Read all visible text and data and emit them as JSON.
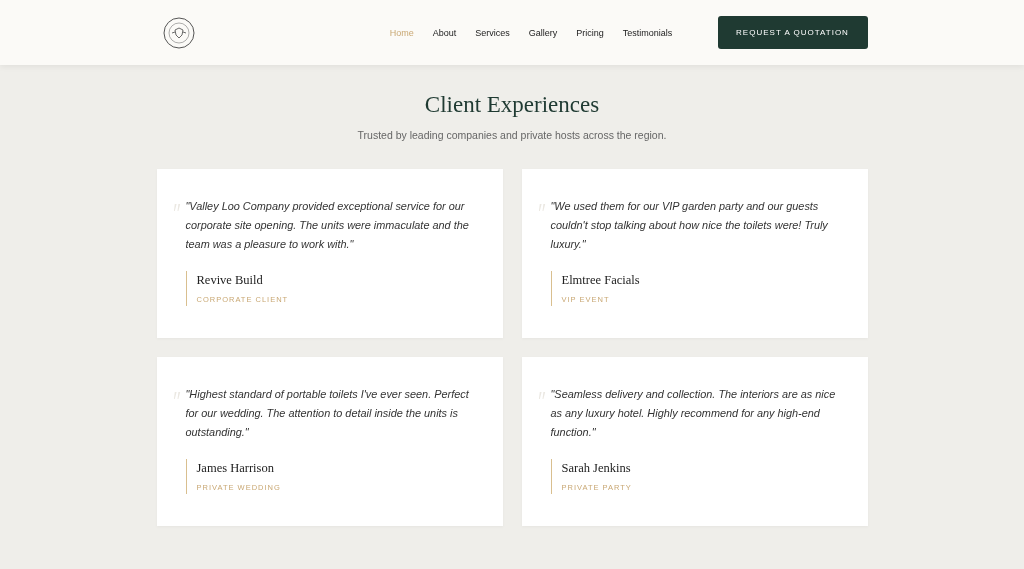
{
  "header": {
    "nav": [
      {
        "label": "Home",
        "selected": true
      },
      {
        "label": "About",
        "selected": false
      },
      {
        "label": "Services",
        "selected": false
      },
      {
        "label": "Gallery",
        "selected": false
      },
      {
        "label": "Pricing",
        "selected": false
      },
      {
        "label": "Testimonials",
        "selected": false
      }
    ],
    "cta": "REQUEST A QUOTATION"
  },
  "section": {
    "title": "Client Experiences",
    "subtitle": "Trusted by leading companies and private hosts across the region.",
    "testimonials": [
      {
        "quote": "\"Valley Loo Company provided exceptional service for our corporate site opening. The units were immaculate and the team was a pleasure to work with.\"",
        "name": "Revive Build",
        "role": "CORPORATE CLIENT"
      },
      {
        "quote": "\"We used them for our VIP garden party and our guests couldn't stop talking about how nice the toilets were! Truly luxury.\"",
        "name": "Elmtree Facials",
        "role": "VIP EVENT"
      },
      {
        "quote": "\"Highest standard of portable toilets I've ever seen. Perfect for our wedding. The attention to detail inside the units is outstanding.\"",
        "name": "James Harrison",
        "role": "PRIVATE WEDDING"
      },
      {
        "quote": "\"Seamless delivery and collection. The interiors are as nice as any luxury hotel. Highly recommend for any high-end function.\"",
        "name": "Sarah Jenkins",
        "role": "PRIVATE PARTY"
      }
    ]
  }
}
